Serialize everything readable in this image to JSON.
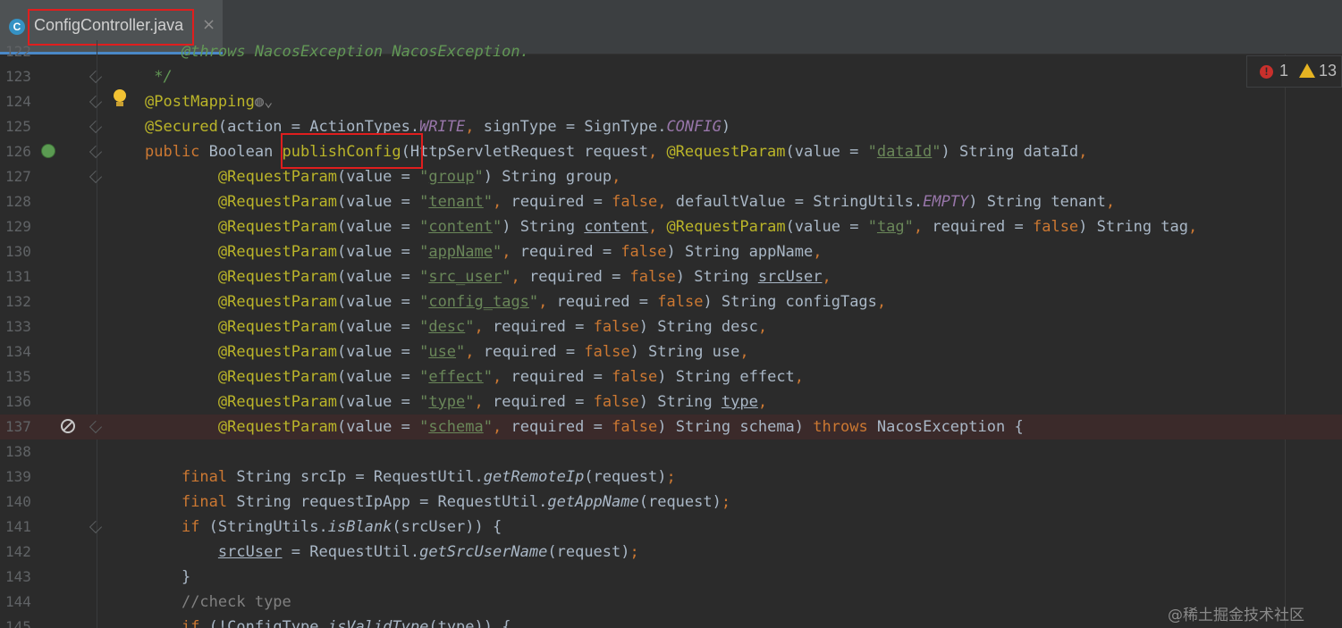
{
  "tab": {
    "label": "ConfigController.java",
    "icon_letter": "C",
    "close": "×"
  },
  "inspection": {
    "errors": "1",
    "warnings": "13"
  },
  "watermark": "@稀土掘金技术社区",
  "lines": [
    {
      "n": "122",
      "tokens": [
        [
          "cmdoc",
          "    @throws NacosException NacosException."
        ]
      ]
    },
    {
      "n": "123",
      "tokens": [
        [
          "cmdoc",
          " */"
        ]
      ]
    },
    {
      "n": "124",
      "tokens": [
        [
          "an",
          "@PostMapping"
        ],
        [
          "cm",
          "◍⌄"
        ]
      ]
    },
    {
      "n": "125",
      "tokens": [
        [
          "an",
          "@Secured"
        ],
        [
          "",
          "(action = ActionTypes."
        ],
        [
          "sf",
          "WRITE"
        ],
        [
          "pn",
          ", "
        ],
        [
          "",
          "signType = SignType."
        ],
        [
          "sf",
          "CONFIG"
        ],
        [
          "",
          ")"
        ]
      ]
    },
    {
      "n": "126",
      "tokens": [
        [
          "kw",
          "public "
        ],
        [
          "",
          "Boolean "
        ],
        [
          "an",
          "publishConfig"
        ],
        [
          "",
          "(HttpServletRequest request"
        ],
        [
          "pn",
          ", "
        ],
        [
          "an",
          "@RequestParam"
        ],
        [
          "",
          "(value = "
        ],
        [
          "str",
          "\""
        ],
        [
          "str-u",
          "dataId"
        ],
        [
          "str",
          "\""
        ],
        [
          "",
          ") String dataId"
        ],
        [
          "pn",
          ","
        ]
      ]
    },
    {
      "n": "127",
      "tokens": [
        [
          "",
          "        "
        ],
        [
          "an",
          "@RequestParam"
        ],
        [
          "",
          "(value = "
        ],
        [
          "str",
          "\""
        ],
        [
          "str-u",
          "group"
        ],
        [
          "str",
          "\""
        ],
        [
          "",
          ") String group"
        ],
        [
          "pn",
          ","
        ]
      ]
    },
    {
      "n": "128",
      "tokens": [
        [
          "",
          "        "
        ],
        [
          "an",
          "@RequestParam"
        ],
        [
          "",
          "(value = "
        ],
        [
          "str",
          "\""
        ],
        [
          "str-u",
          "tenant"
        ],
        [
          "str",
          "\""
        ],
        [
          "pn",
          ", "
        ],
        [
          "",
          "required = "
        ],
        [
          "kw",
          "false"
        ],
        [
          "pn",
          ", "
        ],
        [
          "",
          "defaultValue = StringUtils."
        ],
        [
          "sf",
          "EMPTY"
        ],
        [
          "",
          ") String tenant"
        ],
        [
          "pn",
          ","
        ]
      ]
    },
    {
      "n": "129",
      "tokens": [
        [
          "",
          "        "
        ],
        [
          "an",
          "@RequestParam"
        ],
        [
          "",
          "(value = "
        ],
        [
          "str",
          "\""
        ],
        [
          "str-u",
          "content"
        ],
        [
          "str",
          "\""
        ],
        [
          "",
          ") String "
        ],
        [
          "ul",
          "content"
        ],
        [
          "pn",
          ", "
        ],
        [
          "an",
          "@RequestParam"
        ],
        [
          "",
          "(value = "
        ],
        [
          "str",
          "\""
        ],
        [
          "str-u",
          "tag"
        ],
        [
          "str",
          "\""
        ],
        [
          "pn",
          ", "
        ],
        [
          "",
          "required = "
        ],
        [
          "kw",
          "false"
        ],
        [
          "",
          ") String tag"
        ],
        [
          "pn",
          ","
        ]
      ]
    },
    {
      "n": "130",
      "tokens": [
        [
          "",
          "        "
        ],
        [
          "an",
          "@RequestParam"
        ],
        [
          "",
          "(value = "
        ],
        [
          "str",
          "\""
        ],
        [
          "str-u",
          "appName"
        ],
        [
          "str",
          "\""
        ],
        [
          "pn",
          ", "
        ],
        [
          "",
          "required = "
        ],
        [
          "kw",
          "false"
        ],
        [
          "",
          ") String appName"
        ],
        [
          "pn",
          ","
        ]
      ]
    },
    {
      "n": "131",
      "tokens": [
        [
          "",
          "        "
        ],
        [
          "an",
          "@RequestParam"
        ],
        [
          "",
          "(value = "
        ],
        [
          "str",
          "\""
        ],
        [
          "str-u",
          "src_user"
        ],
        [
          "str",
          "\""
        ],
        [
          "pn",
          ", "
        ],
        [
          "",
          "required = "
        ],
        [
          "kw",
          "false"
        ],
        [
          "",
          ") String "
        ],
        [
          "ul",
          "srcUser"
        ],
        [
          "pn",
          ","
        ]
      ]
    },
    {
      "n": "132",
      "tokens": [
        [
          "",
          "        "
        ],
        [
          "an",
          "@RequestParam"
        ],
        [
          "",
          "(value = "
        ],
        [
          "str",
          "\""
        ],
        [
          "str-u",
          "config_tags"
        ],
        [
          "str",
          "\""
        ],
        [
          "pn",
          ", "
        ],
        [
          "",
          "required = "
        ],
        [
          "kw",
          "false"
        ],
        [
          "",
          ") String configTags"
        ],
        [
          "pn",
          ","
        ]
      ]
    },
    {
      "n": "133",
      "tokens": [
        [
          "",
          "        "
        ],
        [
          "an",
          "@RequestParam"
        ],
        [
          "",
          "(value = "
        ],
        [
          "str",
          "\""
        ],
        [
          "str-u",
          "desc"
        ],
        [
          "str",
          "\""
        ],
        [
          "pn",
          ", "
        ],
        [
          "",
          "required = "
        ],
        [
          "kw",
          "false"
        ],
        [
          "",
          ") String desc"
        ],
        [
          "pn",
          ","
        ]
      ]
    },
    {
      "n": "134",
      "tokens": [
        [
          "",
          "        "
        ],
        [
          "an",
          "@RequestParam"
        ],
        [
          "",
          "(value = "
        ],
        [
          "str",
          "\""
        ],
        [
          "str-u",
          "use"
        ],
        [
          "str",
          "\""
        ],
        [
          "pn",
          ", "
        ],
        [
          "",
          "required = "
        ],
        [
          "kw",
          "false"
        ],
        [
          "",
          ") String use"
        ],
        [
          "pn",
          ","
        ]
      ]
    },
    {
      "n": "135",
      "tokens": [
        [
          "",
          "        "
        ],
        [
          "an",
          "@RequestParam"
        ],
        [
          "",
          "(value = "
        ],
        [
          "str",
          "\""
        ],
        [
          "str-u",
          "effect"
        ],
        [
          "str",
          "\""
        ],
        [
          "pn",
          ", "
        ],
        [
          "",
          "required = "
        ],
        [
          "kw",
          "false"
        ],
        [
          "",
          ") String effect"
        ],
        [
          "pn",
          ","
        ]
      ]
    },
    {
      "n": "136",
      "tokens": [
        [
          "",
          "        "
        ],
        [
          "an",
          "@RequestParam"
        ],
        [
          "",
          "(value = "
        ],
        [
          "str",
          "\""
        ],
        [
          "str-u",
          "type"
        ],
        [
          "str",
          "\""
        ],
        [
          "pn",
          ", "
        ],
        [
          "",
          "required = "
        ],
        [
          "kw",
          "false"
        ],
        [
          "",
          ") String "
        ],
        [
          "ul",
          "type"
        ],
        [
          "pn",
          ","
        ]
      ]
    },
    {
      "n": "137",
      "error": true,
      "tokens": [
        [
          "",
          "        "
        ],
        [
          "an",
          "@RequestParam"
        ],
        [
          "",
          "(value = "
        ],
        [
          "str",
          "\""
        ],
        [
          "str-u",
          "schema"
        ],
        [
          "str",
          "\""
        ],
        [
          "pn",
          ", "
        ],
        [
          "",
          "required = "
        ],
        [
          "kw",
          "false"
        ],
        [
          "",
          ") String schema) "
        ],
        [
          "kw",
          "throws "
        ],
        [
          "",
          "NacosException {"
        ]
      ]
    },
    {
      "n": "138",
      "tokens": []
    },
    {
      "n": "139",
      "tokens": [
        [
          "",
          "    "
        ],
        [
          "kw",
          "final "
        ],
        [
          "",
          "String srcIp = RequestUtil."
        ],
        [
          "mi",
          "getRemoteIp"
        ],
        [
          "",
          "(request)"
        ],
        [
          "pn",
          ";"
        ]
      ]
    },
    {
      "n": "140",
      "tokens": [
        [
          "",
          "    "
        ],
        [
          "kw",
          "final "
        ],
        [
          "",
          "String requestIpApp = RequestUtil."
        ],
        [
          "mi",
          "getAppName"
        ],
        [
          "",
          "(request)"
        ],
        [
          "pn",
          ";"
        ]
      ]
    },
    {
      "n": "141",
      "tokens": [
        [
          "",
          "    "
        ],
        [
          "kw",
          "if "
        ],
        [
          "",
          "(StringUtils."
        ],
        [
          "mi",
          "isBlank"
        ],
        [
          "",
          "(srcUser)) {"
        ]
      ]
    },
    {
      "n": "142",
      "tokens": [
        [
          "",
          "        "
        ],
        [
          "ul",
          "srcUser"
        ],
        [
          "",
          " = RequestUtil."
        ],
        [
          "mi",
          "getSrcUserName"
        ],
        [
          "",
          "(request)"
        ],
        [
          "pn",
          ";"
        ]
      ]
    },
    {
      "n": "143",
      "tokens": [
        [
          "",
          "    }"
        ]
      ]
    },
    {
      "n": "144",
      "tokens": [
        [
          "",
          "    "
        ],
        [
          "cm",
          "//check type"
        ]
      ]
    },
    {
      "n": "145",
      "tokens": [
        [
          "",
          "    "
        ],
        [
          "kw",
          "if "
        ],
        [
          "",
          "(!ConfigType."
        ],
        [
          "mi",
          "isValidType"
        ],
        [
          "",
          "(type)) {"
        ]
      ]
    }
  ]
}
